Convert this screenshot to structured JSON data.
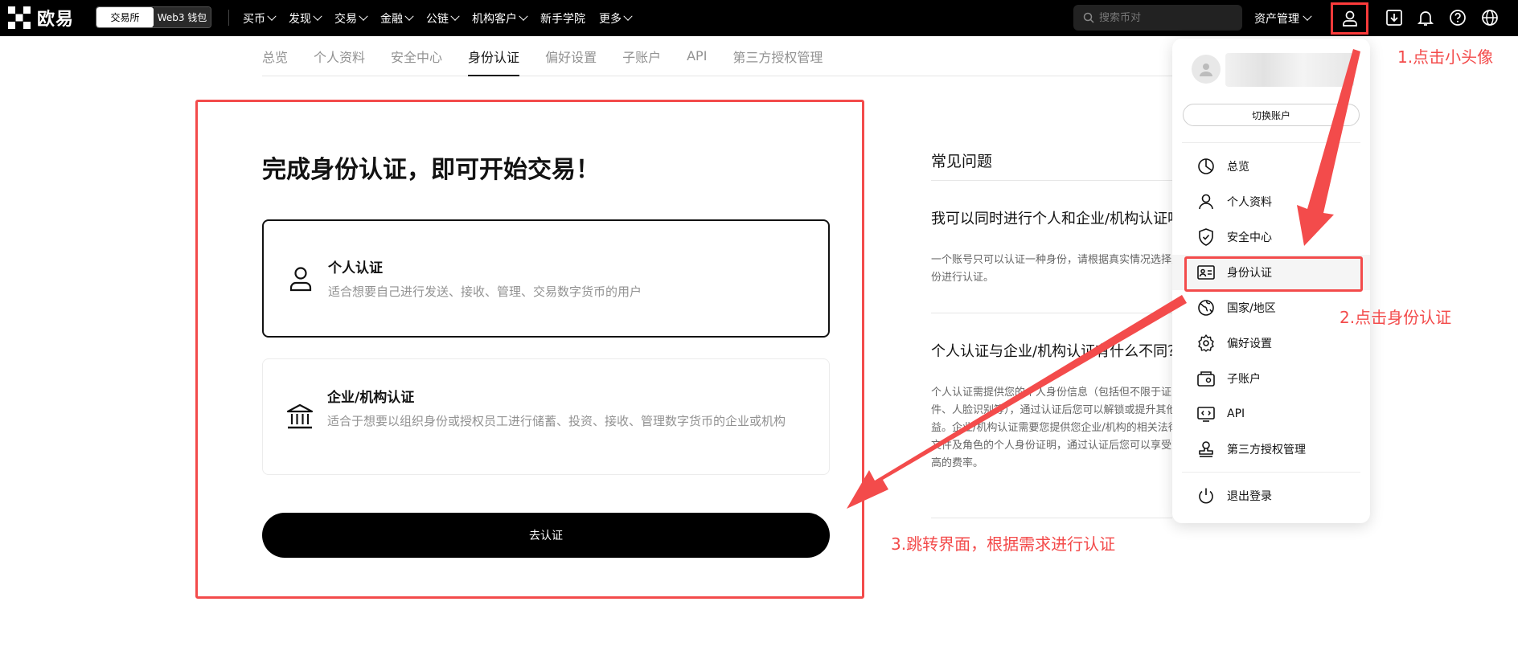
{
  "brand": {
    "name": "欧易"
  },
  "topnav": {
    "segment": [
      "交易所",
      "Web3 钱包"
    ],
    "menu": [
      {
        "label": "买币",
        "has_chevron": true
      },
      {
        "label": "发现",
        "has_chevron": true
      },
      {
        "label": "交易",
        "has_chevron": true
      },
      {
        "label": "金融",
        "has_chevron": true
      },
      {
        "label": "公链",
        "has_chevron": true
      },
      {
        "label": "机构客户",
        "has_chevron": true
      },
      {
        "label": "新手学院",
        "has_chevron": false
      },
      {
        "label": "更多",
        "has_chevron": true
      }
    ],
    "search_placeholder": "搜索币对",
    "asset_label": "资产管理",
    "icons": [
      "user-icon",
      "download-icon",
      "bell-icon",
      "help-icon",
      "globe-icon"
    ]
  },
  "subtabs": [
    "总览",
    "个人资料",
    "安全中心",
    "身份认证",
    "偏好设置",
    "子账户",
    "API",
    "第三方授权管理"
  ],
  "active_subtab": "身份认证",
  "main": {
    "title": "完成身份认证，即可开始交易！",
    "cards": [
      {
        "title": "个人认证",
        "desc": "适合想要自己进行发送、接收、管理、交易数字货币的用户",
        "icon": "person-icon"
      },
      {
        "title": "企业/机构认证",
        "desc": "适合于想要以组织身份或授权员工进行储蓄、投资、接收、管理数字货币的企业或机构",
        "icon": "bank-icon"
      }
    ],
    "button_label": "去认证"
  },
  "faq": {
    "title": "常见问题",
    "items": [
      {
        "q": "我可以同时进行个人和企业/机构认证吗",
        "a": "一个账号只可以认证一种身份，请根据真实情况选择身份进行认证。"
      },
      {
        "q": "个人认证与企业/机构认证有什么不同？",
        "a": "个人认证需提供您的个人身份信息（包括但不限于证件、人脸识别等），通过认证后您可以解锁或提升其他权益。企业/机构认证需要您提供您企业/机构的相关法律文件及角色的个人身份证明，通过认证后您可以享受更高的费率。"
      }
    ]
  },
  "dropdown": {
    "switch_label": "切换账户",
    "items": [
      {
        "label": "总览",
        "icon": "pie-chart-icon"
      },
      {
        "label": "个人资料",
        "icon": "user-icon"
      },
      {
        "label": "安全中心",
        "icon": "shield-icon"
      },
      {
        "label": "身份认证",
        "icon": "id-card-icon"
      },
      {
        "label": "国家/地区",
        "icon": "globe-region-icon"
      },
      {
        "label": "偏好设置",
        "icon": "gear-icon"
      },
      {
        "label": "子账户",
        "icon": "sub-account-icon"
      },
      {
        "label": "API",
        "icon": "api-icon"
      },
      {
        "label": "第三方授权管理",
        "icon": "stamp-icon"
      }
    ],
    "logout_label": "退出登录"
  },
  "annotations": {
    "step1": "1.点击小头像",
    "step2": "2.点击身份认证",
    "step3": "3.跳转界面，根据需求进行认证",
    "color": "#f34b4b"
  }
}
